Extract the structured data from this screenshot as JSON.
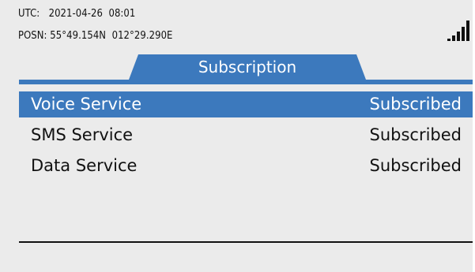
{
  "header": {
    "utc": "UTC:   2021-04-26  08:01",
    "posn": "POSN: 55°49.154N  012°29.290E",
    "signal_strength_bars": 5,
    "signal_icon": "signal-strength-icon"
  },
  "tab": {
    "label": "Subscription"
  },
  "services": [
    {
      "name": "Voice Service",
      "status": "Subscribed",
      "selected": true
    },
    {
      "name": "SMS Service",
      "status": "Subscribed",
      "selected": false
    },
    {
      "name": "Data Service",
      "status": "Subscribed",
      "selected": false
    }
  ],
  "colors": {
    "background": "#ebebeb",
    "accent": "#3c79bd",
    "text": "#111111",
    "selected_text": "#ffffff"
  }
}
